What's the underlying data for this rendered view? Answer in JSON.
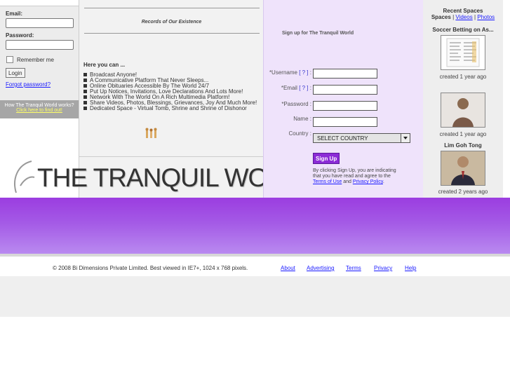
{
  "login": {
    "email_label": "Email:",
    "password_label": "Password:",
    "remember_label": "Remember me",
    "login_button": "Login",
    "forgot_link": "Forgot password?",
    "how_question": "How The Tranquil World works?",
    "how_link": "Click here to find out!"
  },
  "middle": {
    "records_title": "Records of Our Existence",
    "here_heading": "Here you can ...",
    "features": [
      "Broadcast Anyone!",
      "A Communicative Platform That Never Sleeps...",
      "Online Obituaries Accessible By The World 24/7",
      "Put Up Notices, Invitations, Love Declarations And Lots More!",
      "Network With The World On A Rich Multimedia Platform!",
      "Share Videos, Photos, Blessings, Grievances, Joy And Much More!",
      "Dedicated Space - Virtual Tomb, Shrine and Shrine of Dishonor"
    ],
    "logo_text": "THE TRANQUIL WORLD"
  },
  "signup": {
    "title": "Sign up for The Tranquil World",
    "username_label": "*Username",
    "email_label": "*Email",
    "password_label": "*Password :",
    "name_label": "Name :",
    "country_label": "Country :",
    "hint": "[ ? ]",
    "colon": ":",
    "country_selected": "SELECT COUNTRY",
    "signup_button": "Sign Up",
    "terms_text_1": "By clicking Sign Up, you are indicating that you have read and agree to the",
    "terms_link": "Terms of Use",
    "terms_and": "and",
    "privacy_link": "Privacy Policy",
    "terms_end": "."
  },
  "spaces": {
    "heading": "Recent Spaces",
    "spaces_label": "Spaces",
    "sep": "|",
    "videos_link": "Videos",
    "photos_link": "Photos",
    "item1_title": "Soccer Betting on As...",
    "item1_created": "created 1 year ago",
    "item2_created": "created 1 year ago",
    "item3_title": "Lim Goh Tong",
    "item3_created": "created 2 years ago"
  },
  "footer": {
    "copyright": "© 2008 Bi Dimensions Private Limited. Best viewed in IE7+, 1024 x 768 pixels.",
    "links": [
      "About",
      "Advertising",
      "Terms",
      "Privacy",
      "Help"
    ]
  },
  "colors": {
    "accent_purple": "#9b3de0",
    "signup_bg": "#efe3fb",
    "link_blue": "#1a1aff"
  }
}
